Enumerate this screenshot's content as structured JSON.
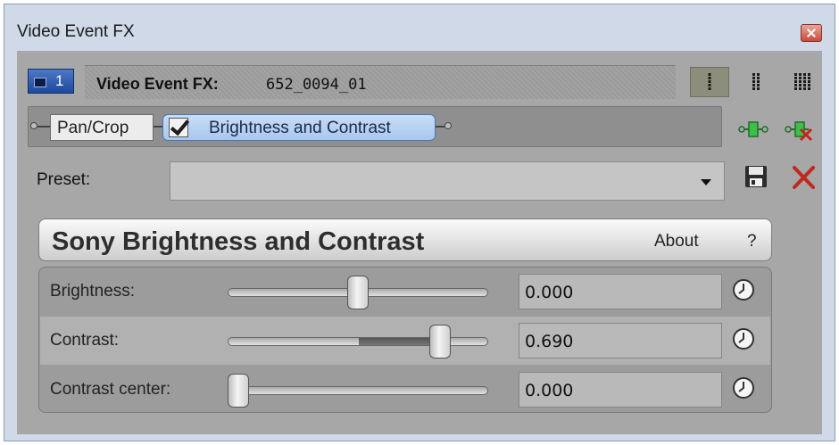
{
  "window": {
    "title": "Video Event FX"
  },
  "header": {
    "chain_number": "1",
    "label": "Video Event FX:",
    "event_name": "652_0094_01",
    "view_modes": [
      "single-column-view",
      "two-column-view",
      "multi-column-view"
    ]
  },
  "chain": {
    "plugins": [
      {
        "label": "Pan/Crop",
        "enabled": true
      },
      {
        "label": "Brightness and Contrast",
        "enabled": true,
        "selected": true
      }
    ],
    "icons": [
      "add-plugin-icon",
      "remove-plugin-icon"
    ]
  },
  "preset": {
    "label": "Preset:",
    "value": ""
  },
  "plugin": {
    "name": "Sony Brightness and Contrast",
    "about_label": "About",
    "help_label": "?"
  },
  "params": [
    {
      "label": "Brightness:",
      "value": "0.000",
      "slider_fraction": 0.5
    },
    {
      "label": "Contrast:",
      "value": "0.690",
      "slider_fraction": 0.845
    },
    {
      "label": "Contrast center:",
      "value": "0.000",
      "slider_fraction": 0.0
    }
  ],
  "colors": {
    "window_bg": "#cfd9e8",
    "panel_bg": "#a7a7a7",
    "selected_plugin": "#a9c8ee",
    "close_button": "#c94b3a"
  }
}
